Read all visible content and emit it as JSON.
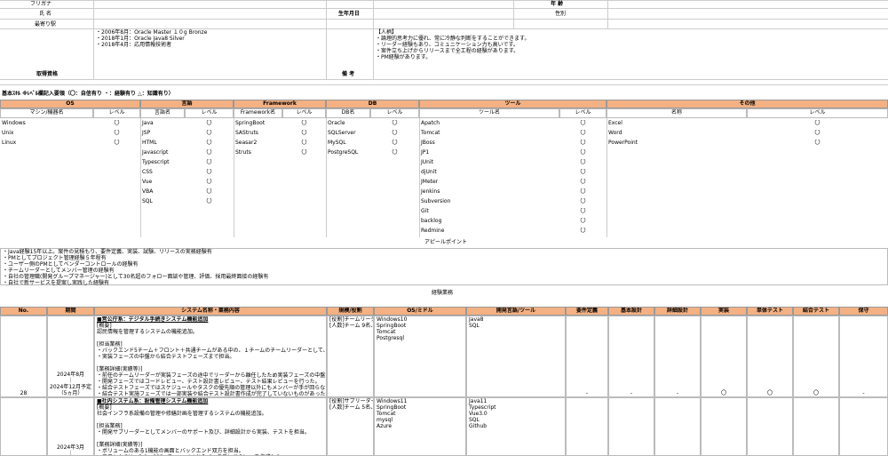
{
  "profile": {
    "furigana_label": "フリガナ",
    "age_label": "年 齢",
    "name_label": "氏 名",
    "birthdate_label": "生年月日",
    "gender_label": "性別",
    "station_label": "最寄り駅",
    "qualifications_label": "取得資格",
    "notes_label": "備 考",
    "qualifications": "・2006年8月：Oracle Master １０g Bronze\n・2018年1月：Oracle Java8 Silver\n・2018年4月：応用情報技術者",
    "notes": "【人柄】\n・論理的思考力に優れ、常に冷静な判断をすることができます。\n・リーダー経験もあり、コミュニケーション力も高いです。\n・案件立ち上げからリリースまで全工程の経験があります。\n・PM経験があります。"
  },
  "skills": {
    "caption": "基本ｽｷﾙ ※ﾚﾍﾞﾙ欄記入要領（〇：自信有り ・：経験有り △：知識有り）",
    "groups": [
      {
        "title": "OS",
        "name_col": "マシン/機器名",
        "level_col": "レベル",
        "items": [
          {
            "name": "Windows",
            "level": "〇"
          },
          {
            "name": "Unix",
            "level": "〇"
          },
          {
            "name": "Linux",
            "level": "〇"
          }
        ]
      },
      {
        "title": "言語",
        "name_col": "言語名",
        "level_col": "レベル",
        "items": [
          {
            "name": "Java",
            "level": "〇"
          },
          {
            "name": "JSP",
            "level": "〇"
          },
          {
            "name": "HTML",
            "level": "〇"
          },
          {
            "name": "Javascript",
            "level": "〇"
          },
          {
            "name": "Typescript",
            "level": "〇"
          },
          {
            "name": "CSS",
            "level": "〇"
          },
          {
            "name": "Vue",
            "level": "〇"
          },
          {
            "name": "VBA",
            "level": "〇"
          },
          {
            "name": "SQL",
            "level": "〇"
          }
        ]
      },
      {
        "title": "Framework",
        "name_col": "Framework名",
        "level_col": "レベル",
        "items": [
          {
            "name": "SpringBoot",
            "level": "〇"
          },
          {
            "name": "SAStruts",
            "level": "〇"
          },
          {
            "name": "Seasar2",
            "level": "〇"
          },
          {
            "name": "Struts",
            "level": "〇"
          }
        ]
      },
      {
        "title": "DB",
        "name_col": "DB名",
        "level_col": "レベル",
        "items": [
          {
            "name": "Oracle",
            "level": "〇"
          },
          {
            "name": "SQLServer",
            "level": "〇"
          },
          {
            "name": "MySQL",
            "level": "〇"
          },
          {
            "name": "PostgreSQL",
            "level": "〇"
          }
        ]
      },
      {
        "title": "ツール",
        "name_col": "ツール名",
        "level_col": "レベル",
        "items": [
          {
            "name": "Apatch",
            "level": "〇"
          },
          {
            "name": "Tomcat",
            "level": "〇"
          },
          {
            "name": "JBoss",
            "level": "〇"
          },
          {
            "name": "JP1",
            "level": "〇"
          },
          {
            "name": "JUnit",
            "level": "〇"
          },
          {
            "name": "djUnit",
            "level": "〇"
          },
          {
            "name": "JMeter",
            "level": "〇"
          },
          {
            "name": "Jenkins",
            "level": "〇"
          },
          {
            "name": "Subversion",
            "level": "〇"
          },
          {
            "name": "Git",
            "level": "〇"
          },
          {
            "name": "backlog",
            "level": "〇"
          },
          {
            "name": "Redmine",
            "level": "〇"
          }
        ]
      },
      {
        "title": "その他",
        "name_col": "名称",
        "level_col": "レベル",
        "items": [
          {
            "name": "Excel",
            "level": "〇"
          },
          {
            "name": "Word",
            "level": "〇"
          },
          {
            "name": "PowerPoint",
            "level": "〇"
          }
        ]
      }
    ]
  },
  "appeal": {
    "title": "アピールポイント",
    "text": "・Java経験15年以上。案件の見積もり、要件定義、実装、試験、リリースの実務経験有\n・PMとしてプロジェクト管理経験５年程有\n・ユーザー側のPMとしてベンダーコントロールの経験有\n・チームリーダーとしてメンバー管理の経験有\n・自社の管理職(開発グループマネージャー)として30名超のフォロー面談や管理、評価、採用最終面接の経験有\n・自社で新サービスを提案し実践した経験有"
  },
  "history": {
    "title": "経験業務",
    "headers": [
      "No.",
      "期間",
      "システム名称・業務内容",
      "規模/役割",
      "OS/ミドル",
      "開発言語/ツール",
      "要件定義",
      "基本設計",
      "詳細設計",
      "実装",
      "単体テスト",
      "結合テスト",
      "保守"
    ],
    "rows": [
      {
        "no": "28",
        "period": "2024年8月\n｜\n2024年12月予定\n（5ヵ月）",
        "content_title": "■営公庁系：デジタル手続きシステム機能追加",
        "content": "[概要]\n認民情報を管理するシステムの機能追加。\n\n[担当業務]\n・バックエンド5チーム＋フロント＋共通チームがある中の、１チームのチームリーダーとして、メンバ\n・実装フェーズの中盤から結合テストフェーズまで担当。\n\n[業務詳細(実績等)]\n・前任のチームリーダーが実装フェーズの途中でリーダーから離任したため実装フェーズの中盤から参入\n・開発フェーズではコードレビュー、テスト設計書レビュー、テスト結果レビューを行った。\n・結合テストフェーズではスケジュールやタスクの優先順の管理以外にもメンバーが手が回らない設計書\n・結合テスト実施フェーズでは一部実装や結合テスト設計書作成が完了していないものがあったが、タス",
        "scale": "[役割]チームリーダー\n[人数]チーム 9名、全",
        "os": "Windows10\nSpringBoot\nTomcat\nPostgresql",
        "lang": "Java8\nSQL",
        "phases": [
          "-",
          "-",
          "-",
          "〇",
          "〇",
          "〇",
          "-"
        ]
      },
      {
        "no": "",
        "period": "2024年3月\n｜",
        "content_title": "■社内システム系：設備管理システム機能追加",
        "content": "[概要]\n社会インフラ系設備の管理や修繕計画を管理するシステムの機能追加。\n\n[担当業務]\n・開発サブリーダーとしてメンバーのサポート及び、詳細設計から実装、テストを担当。\n\n[業務詳細(実績等)]\n・ボリュームのある1機能の画面とバックエンド双方を担当。\n・フロントのVue3.0、CSS、Typescriptからバックエンドのjavaを作成した。",
        "scale": "[役割]サブリーダー\n[人数]チーム 5名、全",
        "os": "Windows11\nSpringBoot\nTomcat\nmysql\nAzure",
        "lang": "Java11\nTypescript\nVue3.0\nSQL\nGithub",
        "phases": [
          "",
          "",
          "",
          "",
          "",
          "",
          ""
        ]
      }
    ]
  }
}
